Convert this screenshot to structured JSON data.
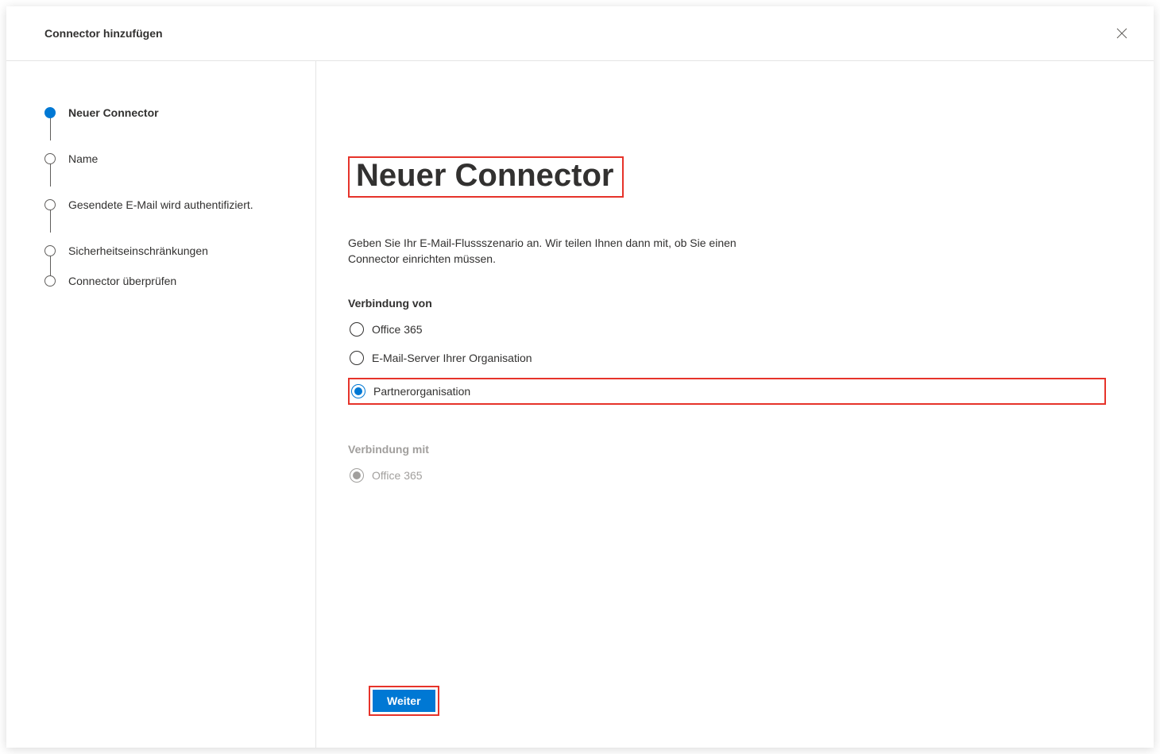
{
  "dialog": {
    "title": "Connector hinzufügen"
  },
  "steps": [
    {
      "label": "Neuer Connector",
      "active": true
    },
    {
      "label": "Name",
      "active": false
    },
    {
      "label": "Gesendete E-Mail wird authentifiziert.",
      "active": false
    },
    {
      "label": "Sicherheitseinschränkungen",
      "active": false
    },
    {
      "label": "Connector überprüfen",
      "active": false
    }
  ],
  "main": {
    "title": "Neuer Connector",
    "description": "Geben Sie Ihr E-Mail-Flussszenario an. Wir teilen Ihnen dann mit, ob Sie einen Connector einrichten müssen.",
    "section_from_label": "Verbindung von",
    "options_from": [
      {
        "label": "Office 365",
        "selected": false,
        "highlighted": false
      },
      {
        "label": "E-Mail-Server Ihrer Organisation",
        "selected": false,
        "highlighted": false
      },
      {
        "label": "Partnerorganisation",
        "selected": true,
        "highlighted": true
      }
    ],
    "section_to_label": "Verbindung mit",
    "options_to": [
      {
        "label": "Office 365",
        "selected": true,
        "disabled": true
      }
    ]
  },
  "footer": {
    "next_label": "Weiter"
  }
}
